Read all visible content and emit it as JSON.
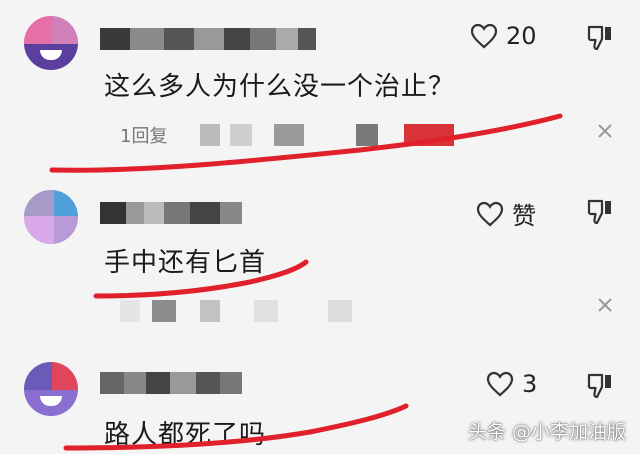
{
  "comments": [
    {
      "text": "这么多人为什么没一个治止？",
      "like_count": "20",
      "reply_text": "1回复"
    },
    {
      "text": "手中还有匕首",
      "like_count": "赞"
    },
    {
      "text": "路人都死了吗",
      "like_count": "3"
    }
  ],
  "watermark": "头条 @小李加油版",
  "colors": {
    "scribble": "#e0202a",
    "censor_dark": "#5a5a5a",
    "censor_red": "#d9333a"
  },
  "icons": [
    "heart-icon",
    "thumbs-down-icon",
    "close-icon",
    "avatar"
  ]
}
